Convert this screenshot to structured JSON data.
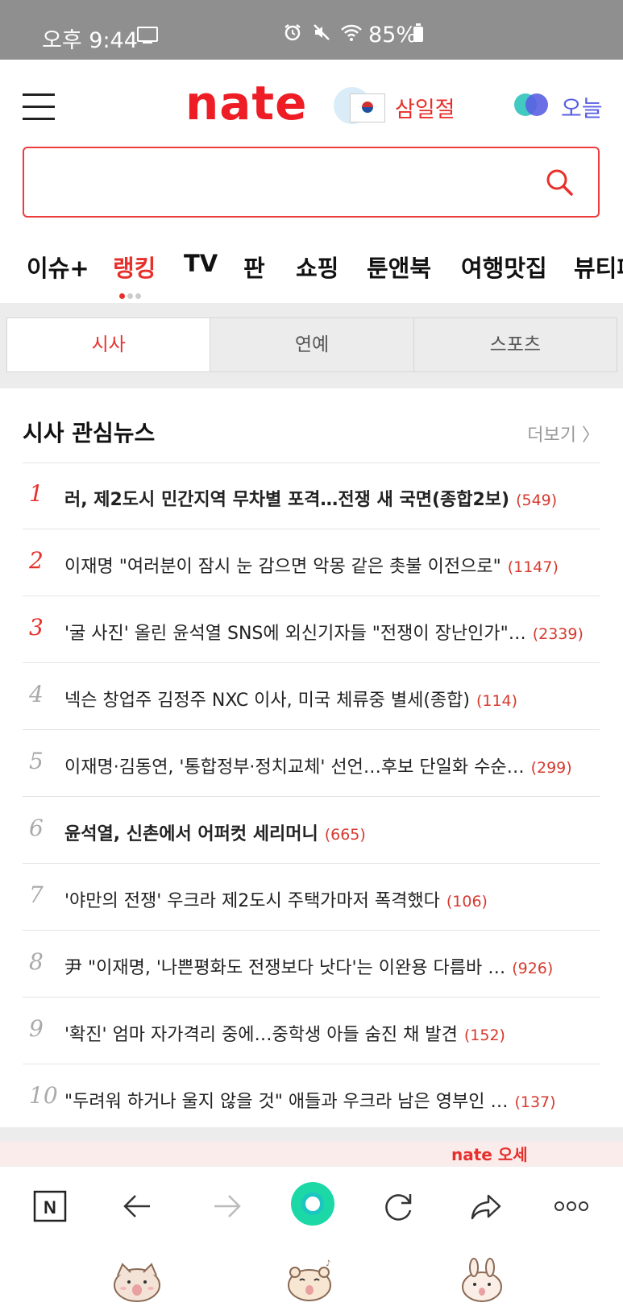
{
  "status": {
    "time": "오후 9:44",
    "battery": "85%"
  },
  "header": {
    "logo": "nate",
    "event_text": "삼일절",
    "today_label": "오늘"
  },
  "search": {
    "placeholder": ""
  },
  "categories": [
    "이슈+",
    "랭킹",
    "TV",
    "판",
    "쇼핑",
    "툰앤북",
    "여행맛집",
    "뷰티패"
  ],
  "subtabs": [
    "시사",
    "연예",
    "스포츠"
  ],
  "news": {
    "title": "시사 관심뉴스",
    "more": "더보기 〉",
    "items": [
      {
        "rank": "1",
        "text": "러, 제2도시 민간지역 무차별 포격…전쟁 새 국면(종합2보)",
        "count": "(549)"
      },
      {
        "rank": "2",
        "text": "이재명 \"여러분이 잠시 눈 감으면 악몽 같은 촛불 이전으로\"",
        "count": "(1147)"
      },
      {
        "rank": "3",
        "text": "'굴 사진' 올린 윤석열 SNS에 외신기자들 \"전쟁이 장난인가\"…",
        "count": "(2339)"
      },
      {
        "rank": "4",
        "text": "넥슨 창업주 김정주 NXC 이사, 미국 체류중 별세(종합)",
        "count": "(114)"
      },
      {
        "rank": "5",
        "text": "이재명·김동연, '통합정부·정치교체' 선언…후보 단일화 수순…",
        "count": "(299)"
      },
      {
        "rank": "6",
        "text": "윤석열, 신촌에서 어퍼컷 세리머니",
        "count": "(665)"
      },
      {
        "rank": "7",
        "text": "'야만의 전쟁' 우크라 제2도시 주택가마저 폭격했다",
        "count": "(106)"
      },
      {
        "rank": "8",
        "text": "尹 \"이재명, '나쁜평화도 전쟁보다 낫다'는 이완용 다름바 …",
        "count": "(926)"
      },
      {
        "rank": "9",
        "text": "'확진' 엄마 자가격리 중에…중학생 아들 숨진 채 발견",
        "count": "(152)"
      },
      {
        "rank": "10",
        "text": "\"두려워 하거나 울지 않을 것\" 애들과 우크라 남은 영부인 …",
        "count": "(137)"
      }
    ]
  },
  "peek": {
    "text": "nate 오세"
  }
}
